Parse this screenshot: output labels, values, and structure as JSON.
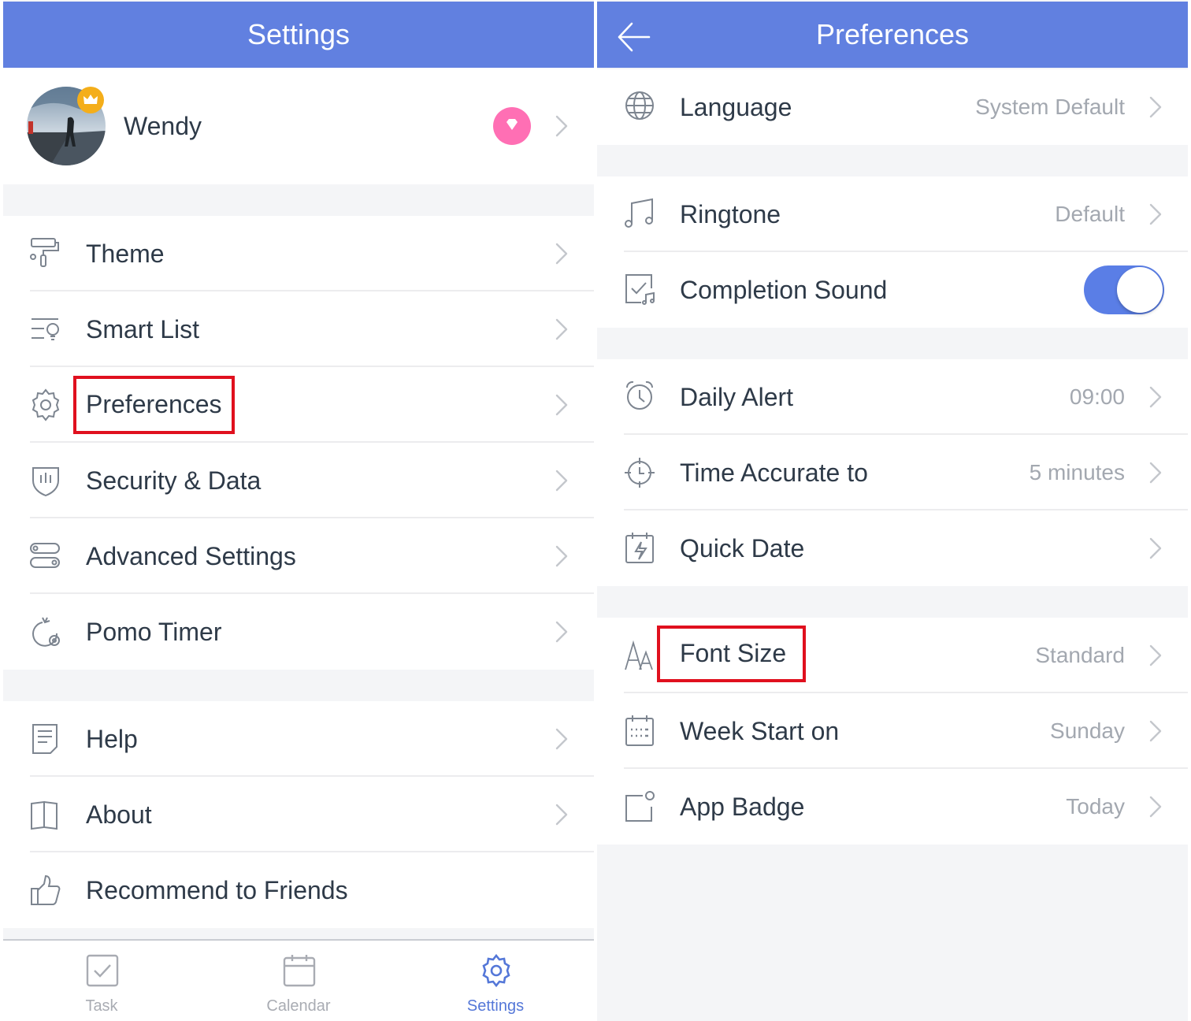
{
  "colors": {
    "header": "#6180e0",
    "accent": "#5a7ee6",
    "text": "#2e3a48",
    "value": "#a3a8b0",
    "highlight": "#e0101e",
    "premium": "#ff6fb4",
    "crown": "#f4ae1a"
  },
  "settings": {
    "header": {
      "title": "Settings"
    },
    "profile": {
      "name": "Wendy",
      "avatar_icon": "user-avatar",
      "badge_icon": "crown-icon",
      "premium_icon": "diamond-icon"
    },
    "menu": [
      {
        "label": "Theme",
        "icon": "paint-roller-icon"
      },
      {
        "label": "Smart List",
        "icon": "smart-list-icon"
      },
      {
        "label": "Preferences",
        "icon": "gear-icon",
        "highlighted": true
      },
      {
        "label": "Security & Data",
        "icon": "shield-icon"
      },
      {
        "label": "Advanced Settings",
        "icon": "toggles-icon"
      },
      {
        "label": "Pomo Timer",
        "icon": "tomato-timer-icon"
      },
      {
        "label": "Help",
        "icon": "document-icon"
      },
      {
        "label": "About",
        "icon": "book-icon"
      },
      {
        "label": "Recommend to Friends",
        "icon": "thumbs-up-icon"
      }
    ],
    "tabs": [
      {
        "label": "Task",
        "icon": "checkbox-icon",
        "active": false
      },
      {
        "label": "Calendar",
        "icon": "calendar-icon",
        "active": false
      },
      {
        "label": "Settings",
        "icon": "gear-icon",
        "active": true
      }
    ]
  },
  "preferences": {
    "header": {
      "title": "Preferences",
      "back_icon": "arrow-left-icon"
    },
    "rows": [
      {
        "label": "Language",
        "value": "System Default",
        "icon": "globe-icon"
      },
      {
        "label": "Ringtone",
        "value": "Default",
        "icon": "music-note-icon"
      },
      {
        "label": "Completion Sound",
        "toggle": true,
        "icon": "check-sound-icon"
      },
      {
        "label": "Daily Alert",
        "value": "09:00",
        "icon": "alarm-clock-icon"
      },
      {
        "label": "Time Accurate to",
        "value": "5 minutes",
        "icon": "target-clock-icon"
      },
      {
        "label": "Quick Date",
        "value": "",
        "icon": "calendar-bolt-icon"
      },
      {
        "label": "Font Size",
        "value": "Standard",
        "icon": "font-size-icon",
        "highlighted": true
      },
      {
        "label": "Week Start on",
        "value": "Sunday",
        "icon": "calendar-week-icon"
      },
      {
        "label": "App Badge",
        "value": "Today",
        "icon": "app-badge-icon"
      }
    ]
  }
}
